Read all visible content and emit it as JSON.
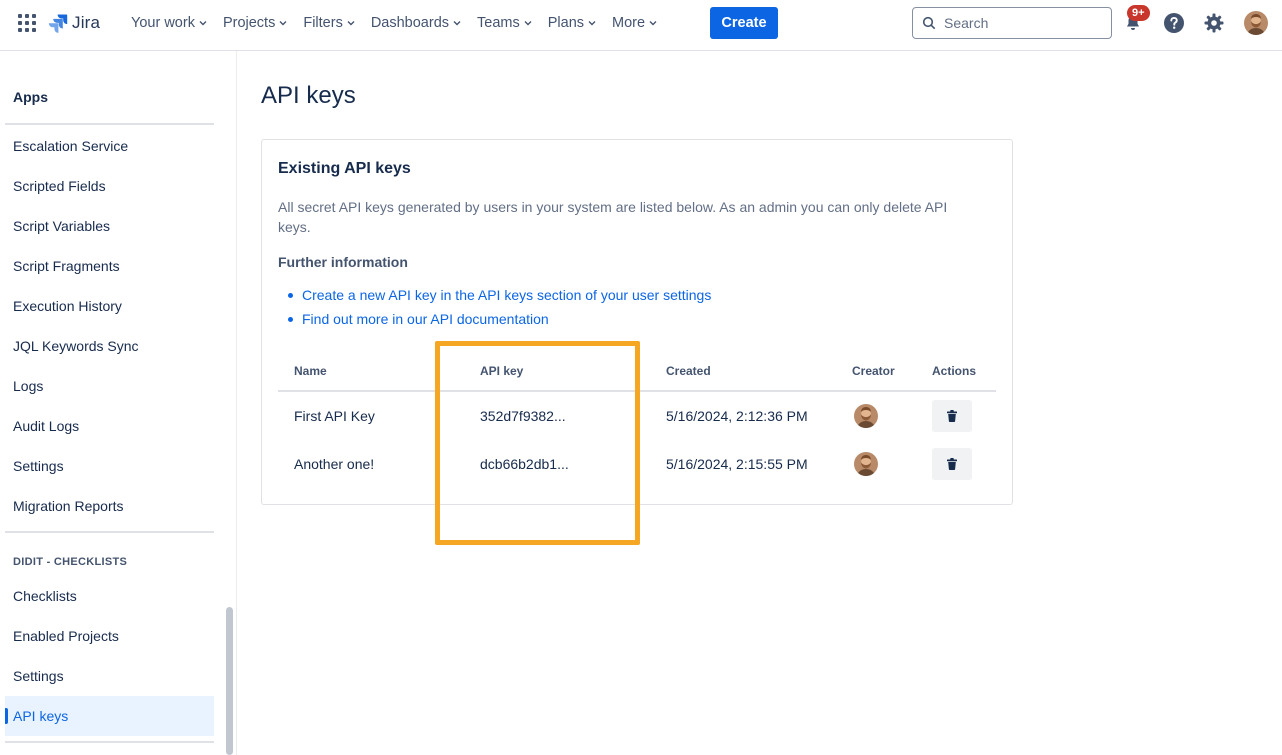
{
  "topnav": {
    "logo_text": "Jira",
    "items": [
      {
        "label": "Your work"
      },
      {
        "label": "Projects"
      },
      {
        "label": "Filters"
      },
      {
        "label": "Dashboards"
      },
      {
        "label": "Teams"
      },
      {
        "label": "Plans"
      },
      {
        "label": "More"
      }
    ],
    "create_label": "Create",
    "search_placeholder": "Search",
    "notifications_badge": "9+"
  },
  "sidebar": {
    "title": "Apps",
    "items": [
      {
        "label": "Escalation Service"
      },
      {
        "label": "Scripted Fields"
      },
      {
        "label": "Script Variables"
      },
      {
        "label": "Script Fragments"
      },
      {
        "label": "Execution History"
      },
      {
        "label": "JQL Keywords Sync"
      },
      {
        "label": "Logs"
      },
      {
        "label": "Audit Logs"
      },
      {
        "label": "Settings"
      },
      {
        "label": "Migration Reports"
      }
    ],
    "section_title": "DIDIT - CHECKLISTS",
    "section_items": [
      {
        "label": "Checklists"
      },
      {
        "label": "Enabled Projects"
      },
      {
        "label": "Settings"
      },
      {
        "label": "API keys",
        "active": true
      }
    ]
  },
  "main": {
    "page_title": "API keys",
    "card": {
      "title": "Existing API keys",
      "description": "All secret API keys generated by users in your system are listed below. As an admin you can only delete API keys.",
      "further_title": "Further information",
      "links": [
        {
          "label": "Create a new API key in the API keys section of your user settings"
        },
        {
          "label": "Find out more in our API documentation"
        }
      ],
      "table": {
        "headers": {
          "name": "Name",
          "key": "API key",
          "created": "Created",
          "creator": "Creator",
          "actions": "Actions"
        },
        "rows": [
          {
            "name": "First API Key",
            "key": "352d7f9382...",
            "created": "5/16/2024, 2:12:36 PM"
          },
          {
            "name": "Another one!",
            "key": "dcb66b2db1...",
            "created": "5/16/2024, 2:15:55 PM"
          }
        ]
      }
    }
  },
  "colors": {
    "accent": "#0c66e4",
    "highlight": "#f5a623",
    "badge": "#c9372c"
  }
}
